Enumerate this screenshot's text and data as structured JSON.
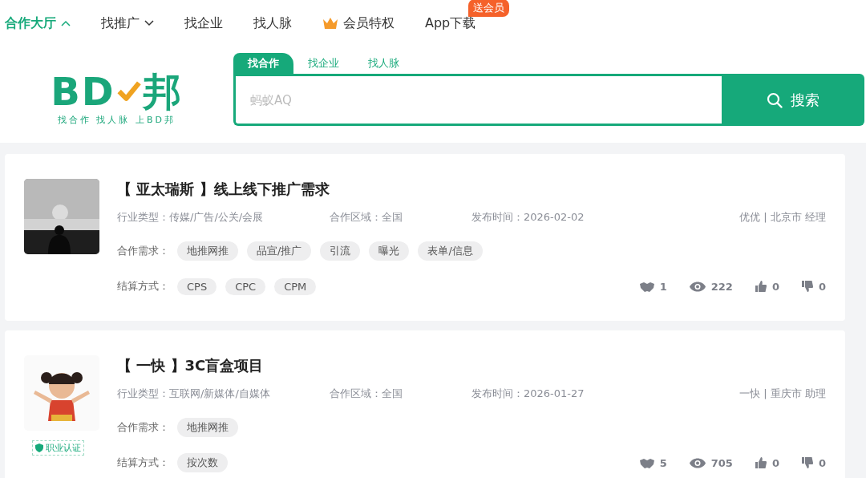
{
  "nav": [
    {
      "label": "合作大厅",
      "selected": true,
      "kind": "dropdown",
      "expanded": true
    },
    {
      "label": "找推广",
      "selected": false,
      "kind": "dropdown",
      "expanded": false
    },
    {
      "label": "找企业",
      "selected": false,
      "kind": "link"
    },
    {
      "label": "找人脉",
      "selected": false,
      "kind": "link"
    },
    {
      "label": "会员特权",
      "selected": false,
      "kind": "vip"
    },
    {
      "label": "App下载",
      "selected": false,
      "kind": "link",
      "badge": "送会员"
    }
  ],
  "logo": {
    "letters": "BD",
    "suffix": "邦",
    "tagline": "找合作 找人脉 上BD邦"
  },
  "search": {
    "tabs": [
      {
        "label": "找合作",
        "selected": true
      },
      {
        "label": "找企业",
        "selected": false
      },
      {
        "label": "找人脉",
        "selected": false
      }
    ],
    "placeholder": "蚂蚁AQ",
    "button": "搜索"
  },
  "listings": [
    {
      "title": "【 亚太瑞斯 】线上线下推广需求",
      "industry_label": "行业类型：",
      "industry": "传媒/广告/公关/会展",
      "region_label": "合作区域：",
      "region": "全国",
      "date_label": "发布时间：",
      "date": "2026-02-02",
      "poster": "优优 | 北京市 经理",
      "needs_label": "合作需求：",
      "needs": [
        "地推网推",
        "品宣/推广",
        "引流",
        "曝光",
        "表单/信息"
      ],
      "settle_label": "结算方式：",
      "settle": [
        "CPS",
        "CPC",
        "CPM"
      ],
      "stats": {
        "deals": "1",
        "views": "222",
        "likes": "0",
        "dislikes": "0"
      }
    },
    {
      "title": "【 一快 】3C盲盒项目",
      "industry_label": "行业类型：",
      "industry": "互联网/新媒体/自媒体",
      "region_label": "合作区域：",
      "region": "全国",
      "date_label": "发布时间：",
      "date": "2026-01-27",
      "poster": "一快 | 重庆市 助理",
      "needs_label": "合作需求：",
      "needs": [
        "地推网推"
      ],
      "settle_label": "结算方式：",
      "settle": [
        "按次数"
      ],
      "stats": {
        "deals": "5",
        "views": "705",
        "likes": "0",
        "dislikes": "0"
      },
      "badge": "职业认证"
    }
  ]
}
